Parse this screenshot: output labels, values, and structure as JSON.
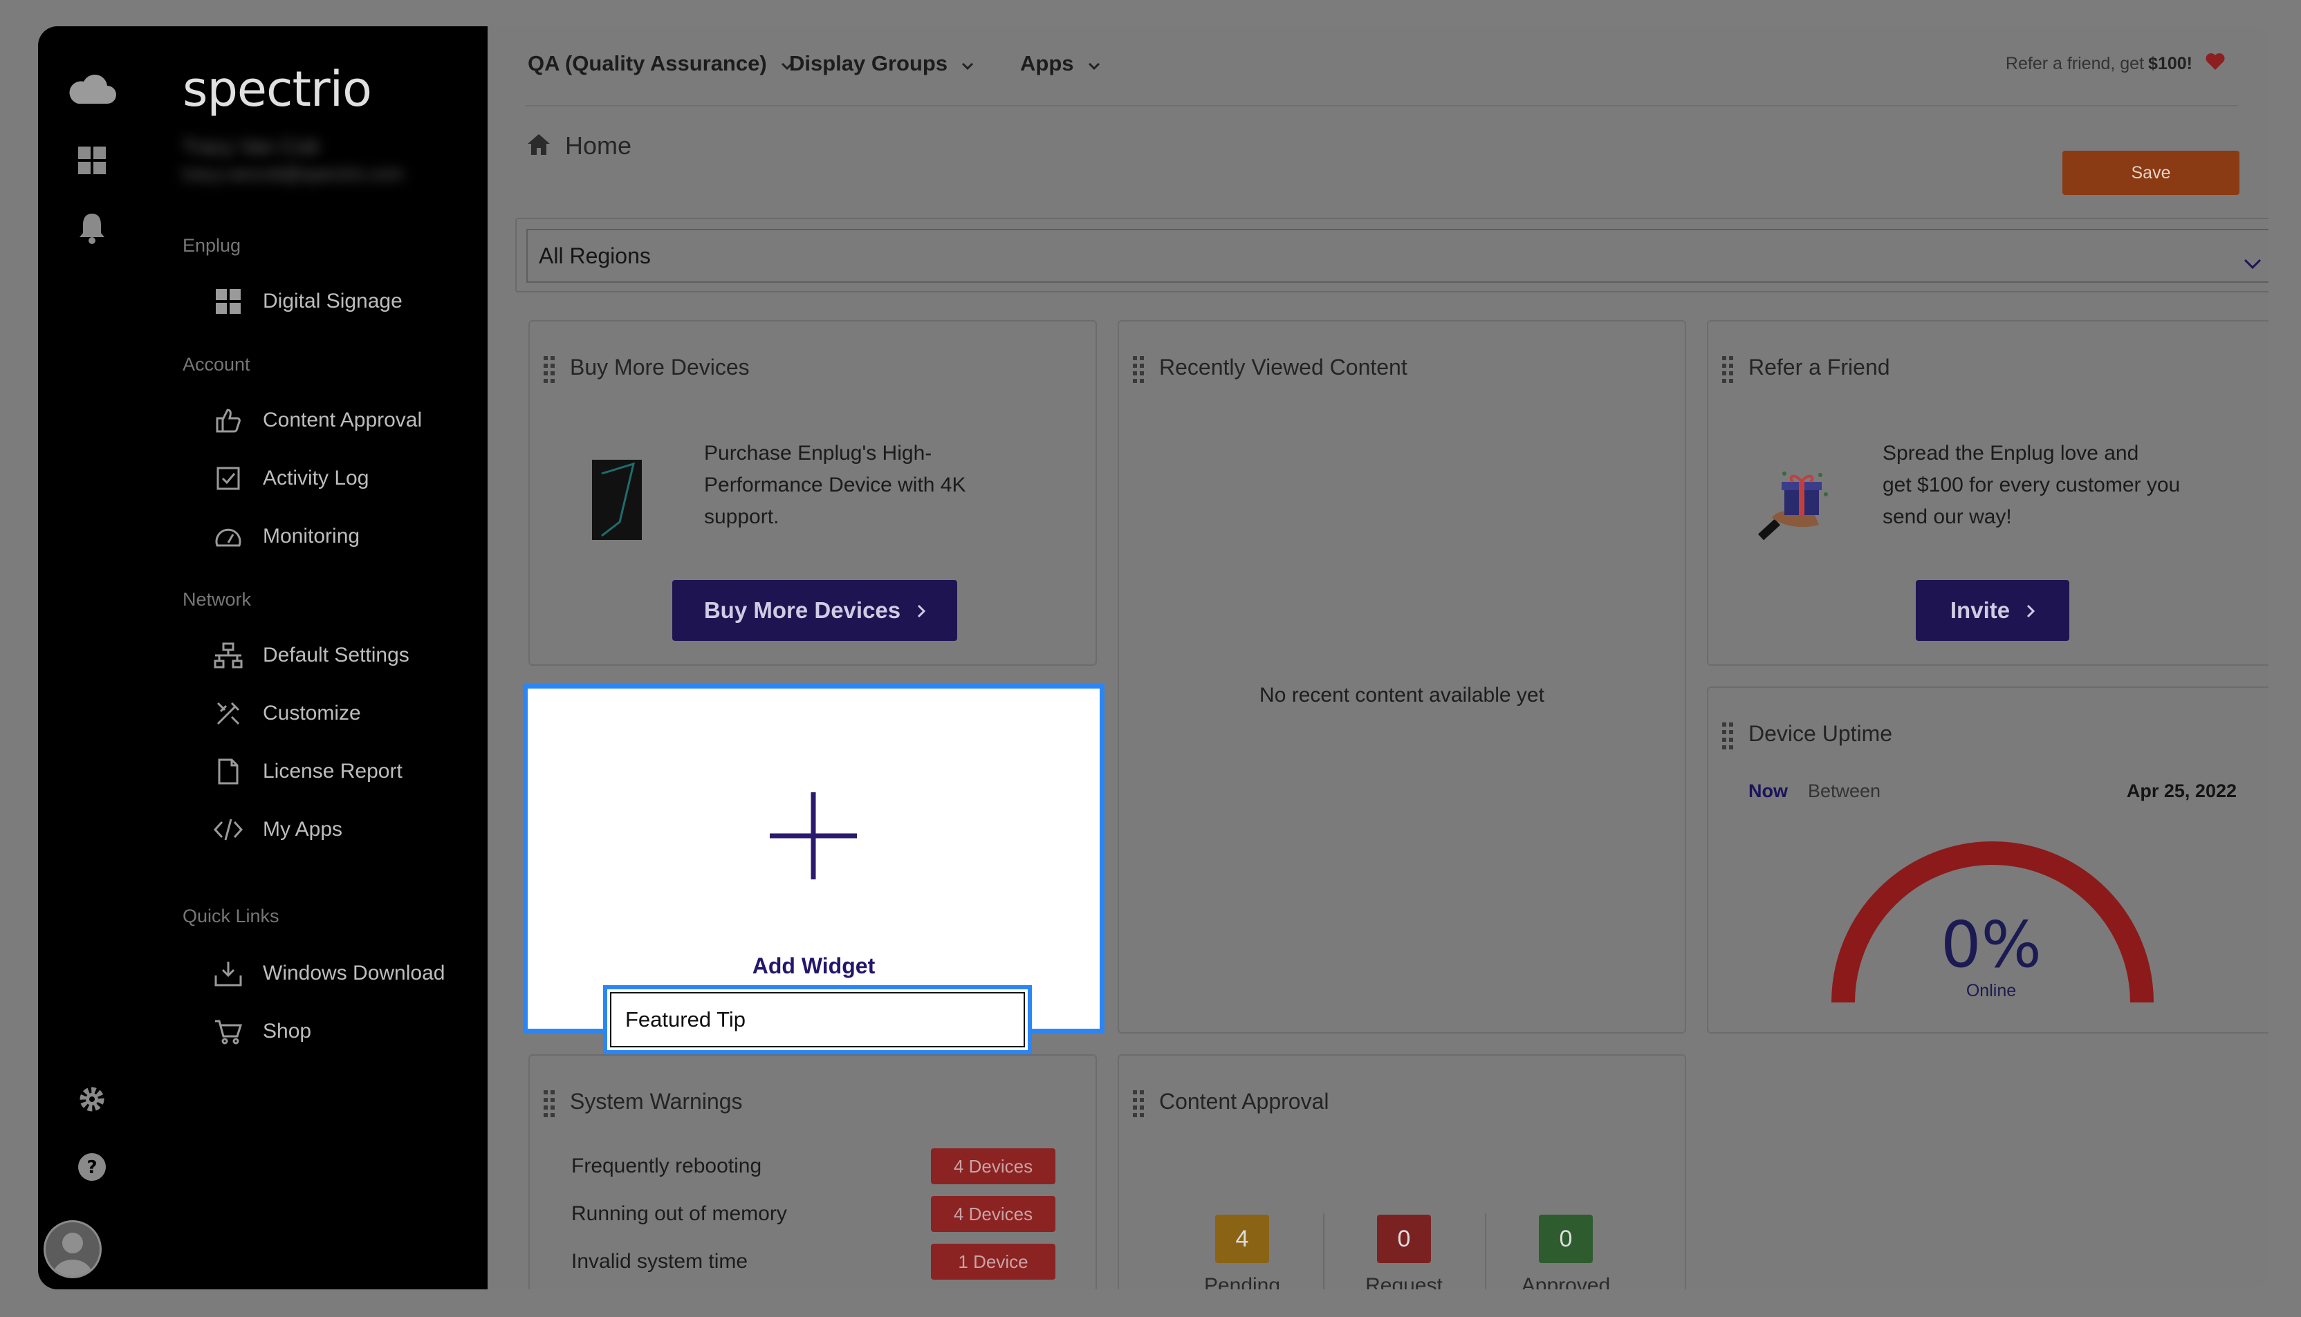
{
  "brand": "spectrio",
  "user": {
    "name": "Tracy Van Cott",
    "email": "tracy.vancott@spectrio.com"
  },
  "sidebar": {
    "sections": [
      {
        "label": "Enplug",
        "items": [
          {
            "label": "Digital Signage",
            "icon": "grid-icon"
          }
        ]
      },
      {
        "label": "Account",
        "items": [
          {
            "label": "Content Approval",
            "icon": "thumbs-up-icon"
          },
          {
            "label": "Activity Log",
            "icon": "checkbox-icon"
          },
          {
            "label": "Monitoring",
            "icon": "speedometer-icon"
          }
        ]
      },
      {
        "label": "Network",
        "items": [
          {
            "label": "Default Settings",
            "icon": "network-icon"
          },
          {
            "label": "Customize",
            "icon": "tools-icon"
          },
          {
            "label": "License Report",
            "icon": "document-icon"
          },
          {
            "label": "My Apps",
            "icon": "code-icon"
          }
        ]
      },
      {
        "label": "Quick Links",
        "items": [
          {
            "label": "Windows Download",
            "icon": "download-tray-icon"
          },
          {
            "label": "Shop",
            "icon": "cart-icon"
          }
        ]
      }
    ]
  },
  "topbar": {
    "menus": [
      "QA (Quality Assurance)",
      "Display Groups",
      "Apps"
    ],
    "refer_text": "Refer a friend, get",
    "refer_amount": "$100!"
  },
  "page": {
    "title": "Home",
    "save_label": "Save"
  },
  "region": {
    "selected": "All Regions"
  },
  "widgets": {
    "buy_devices": {
      "title": "Buy More Devices",
      "desc_lines": [
        "Purchase Enplug's High-",
        "Performance Device with 4K",
        "support."
      ],
      "button": "Buy More Devices"
    },
    "recent_content": {
      "title": "Recently Viewed Content",
      "empty": "No recent content available yet"
    },
    "refer": {
      "title": "Refer a Friend",
      "desc_lines": [
        "Spread the Enplug love and",
        "get $100 for every customer you",
        "send our way!"
      ],
      "button": "Invite"
    },
    "add_widget": {
      "label": "Add Widget",
      "input_value": "Featured Tip"
    },
    "uptime": {
      "title": "Device Uptime",
      "tab_now": "Now",
      "tab_between": "Between",
      "date": "Apr 25, 2022",
      "percent_text": "0%",
      "percent_value": 0,
      "status": "Online"
    },
    "warnings": {
      "title": "System Warnings",
      "rows": [
        {
          "label": "Frequently rebooting",
          "badge": "4 Devices"
        },
        {
          "label": "Running out of memory",
          "badge": "4 Devices"
        },
        {
          "label": "Invalid system time",
          "badge": "1 Device"
        }
      ]
    },
    "approval": {
      "title": "Content Approval",
      "cols": [
        {
          "count": "4",
          "label": "Pending",
          "color": "#8a6414"
        },
        {
          "count": "0",
          "label": "Request",
          "color": "#7a2222"
        },
        {
          "count": "0",
          "label": "Approved",
          "color": "#2e5c2e"
        }
      ]
    }
  },
  "colors": {
    "accent": "#1f1452",
    "save": "#8a3b14",
    "focus": "#2b86f5",
    "gauge": "#8c1a1a"
  }
}
